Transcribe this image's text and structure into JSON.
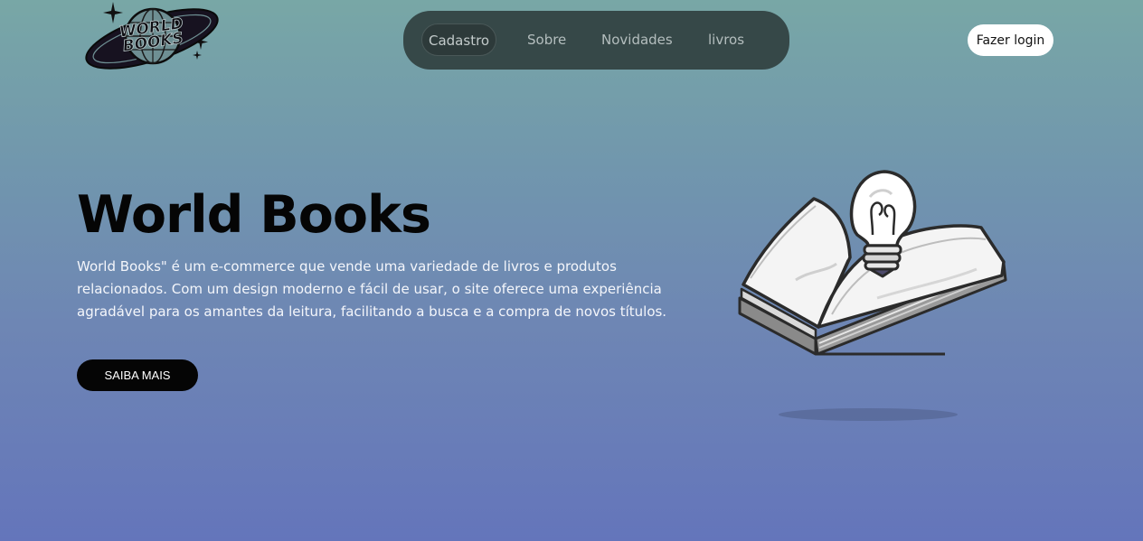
{
  "header": {
    "logo": {
      "icon": "globe-logo-icon",
      "text_line1": "WORLD",
      "text_line2": "BOOKS"
    },
    "nav": [
      {
        "label": "Cadastro",
        "active": true
      },
      {
        "label": "Sobre",
        "active": false
      },
      {
        "label": "Novidades",
        "active": false
      },
      {
        "label": "livros",
        "active": false
      }
    ],
    "login_label": "Fazer login"
  },
  "hero": {
    "title": "World Books",
    "description": "World Books\" é um e-commerce que vende uma variedade de livros e produtos relacionados. Com um design moderno e fácil de usar, o site oferece uma experiência agradável para os amantes da leitura, facilitando a busca e a compra de novos títulos.",
    "cta_label": "SAIBA MAIS",
    "illustration_icon": "open-book-lightbulb-icon"
  },
  "colors": {
    "gradient_top": "#78a7a6",
    "gradient_bottom": "#6475bb",
    "nav_bg": "#364848",
    "text_dark": "#050505",
    "text_light": "#f4f6fb"
  }
}
